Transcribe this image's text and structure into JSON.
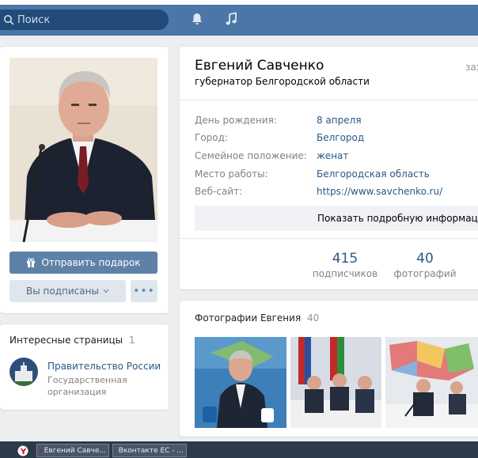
{
  "header": {
    "search_placeholder": "Поиск",
    "icons": [
      "search-icon",
      "bell-icon",
      "music-icon"
    ]
  },
  "profile": {
    "name": "Евгений Савченко",
    "status": "губернатор Белгородской области",
    "online_partial": "зах",
    "info": [
      {
        "label": "День рождения:",
        "value": "8 апреля"
      },
      {
        "label": "Город:",
        "value": "Белгород"
      },
      {
        "label": "Семейное положение:",
        "value": "женат"
      },
      {
        "label": "Место работы:",
        "value": "Белгородская область"
      },
      {
        "label": "Веб-сайт:",
        "value": "https://www.savchenko.ru/"
      }
    ],
    "show_more": "Показать подробную информацию",
    "stats": [
      {
        "count": "415",
        "label": "подписчиков"
      },
      {
        "count": "40",
        "label": "фотографий"
      }
    ]
  },
  "actions": {
    "gift_button": "Отправить подарок",
    "subscribed_button": "Вы подписаны",
    "more_button": "•••"
  },
  "interesting": {
    "title": "Интересные страницы",
    "count": "1",
    "item_name": "Правительство России",
    "item_desc_1": "Государственная",
    "item_desc_2": "организация"
  },
  "photos": {
    "title": "Фотографии Евгения",
    "count": "40"
  },
  "taskbar": {
    "items": [
      "Евгений Савче...",
      "Вконтакте ЕС - ..."
    ]
  },
  "colors": {
    "header": "#4a76a8",
    "link": "#2a5885",
    "button": "#5e81a8"
  }
}
